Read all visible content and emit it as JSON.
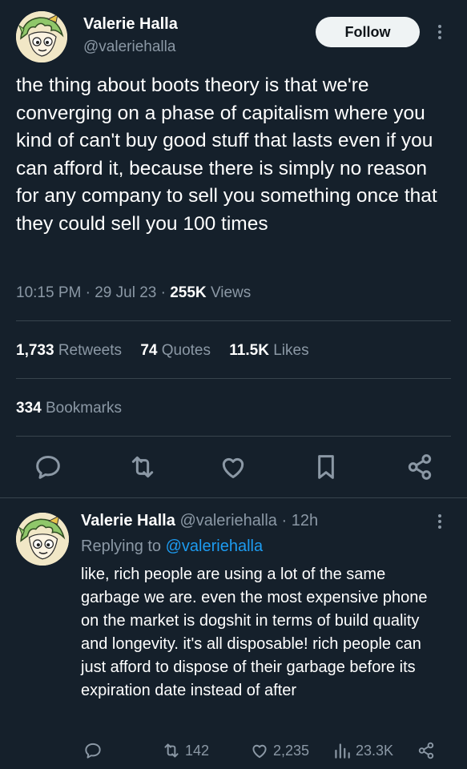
{
  "tweet": {
    "author_name": "Valerie Halla",
    "author_handle": "@valeriehalla",
    "follow_label": "Follow",
    "text": "the thing about boots theory is that we're converging on a phase of capitalism where you kind of can't buy good stuff that lasts even if you can afford it, because there is simply no reason for any company to sell you something once that they could sell you 100 times",
    "time": "10:15 PM",
    "date": "29 Jul 23",
    "views_count": "255K",
    "views_label": "Views"
  },
  "stats": {
    "retweets_count": "1,733",
    "retweets_label": "Retweets",
    "quotes_count": "74",
    "quotes_label": "Quotes",
    "likes_count": "11.5K",
    "likes_label": "Likes",
    "bookmarks_count": "334",
    "bookmarks_label": "Bookmarks"
  },
  "actions": {
    "icons": [
      "reply-icon",
      "retweet-icon",
      "like-icon",
      "bookmark-icon",
      "share-icon"
    ]
  },
  "reply": {
    "author_name": "Valerie Halla",
    "author_handle": "@valeriehalla",
    "age": "12h",
    "replying_prefix": "Replying to",
    "replying_to": "@valeriehalla",
    "text": "like, rich people are using a lot of the same garbage we are. even the most expensive phone on the market is dogshit in terms of build quality and longevity. it's all disposable! rich people can just afford to dispose of their garbage before its expiration date instead of after",
    "retweets": "142",
    "likes": "2,235",
    "views": "23.3K"
  },
  "colors": {
    "background": "#15202b",
    "muted": "#8b98a5",
    "link": "#1d9bf0",
    "divider": "#38444d"
  }
}
